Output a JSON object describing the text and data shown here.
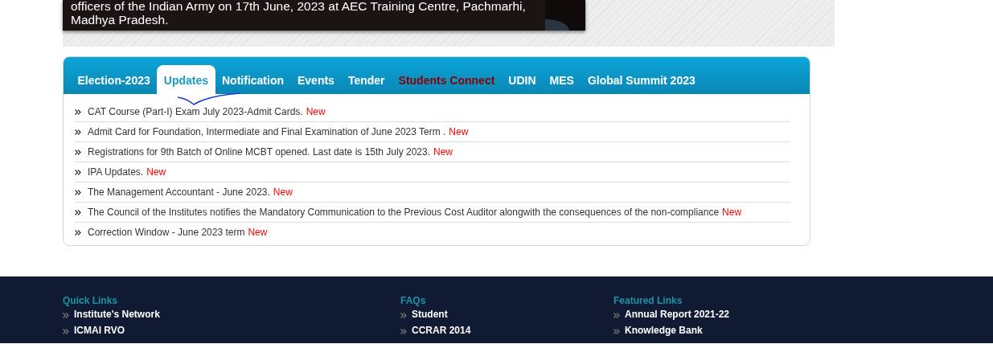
{
  "banner": {
    "kind": "picture",
    "caption": "officers of the Indian Army on 17th June, 2023 at AEC Training Centre, Pachmarhi, Madhya Pradesh."
  },
  "tabs": [
    {
      "label": "Election-2023",
      "selected": false,
      "kind": "normal"
    },
    {
      "label": "Updates",
      "selected": true,
      "kind": "normal"
    },
    {
      "label": "Notification",
      "selected": false,
      "kind": "normal"
    },
    {
      "label": "Events",
      "selected": false,
      "kind": "normal"
    },
    {
      "label": "Tender",
      "selected": false,
      "kind": "normal"
    },
    {
      "label": "Students Connect",
      "selected": false,
      "kind": "highlight"
    },
    {
      "label": "UDIN",
      "selected": false,
      "kind": "normal"
    },
    {
      "label": "MES",
      "selected": false,
      "kind": "normal"
    },
    {
      "label": "Global Summit 2023",
      "selected": false,
      "kind": "normal"
    }
  ],
  "updates": [
    {
      "text": "CAT Course (Part-I) Exam July 2023-Admit Cards.",
      "badge": "New"
    },
    {
      "text": "Admit Card for Foundation, Intermediate and Final Examination of June 2023 Term .",
      "badge": "New"
    },
    {
      "text": "Registrations for 9th Batch of Online MCBT opened. Last date is 15th July 2023.",
      "badge": "New"
    },
    {
      "text": "IPA Updates.",
      "badge": "New"
    },
    {
      "text": "The Management Accountant - June 2023.",
      "badge": "New"
    },
    {
      "text": "The Council of the Institutes notifies the Mandatory Communication to the Previous Cost Auditor alongwith the consequences of the non-compliance",
      "badge": "New"
    },
    {
      "text": "Correction Window - June 2023 term",
      "badge": "New"
    }
  ],
  "footer": [
    {
      "heading": "Quick Links",
      "links": [
        "Institute's Network",
        "ICMAI RVO"
      ]
    },
    {
      "heading": "FAQs",
      "links": [
        "Student",
        "CCRAR 2014"
      ]
    },
    {
      "heading": "Featured Links",
      "links": [
        "Annual Report 2021-22",
        "Knowledge Bank"
      ]
    }
  ]
}
